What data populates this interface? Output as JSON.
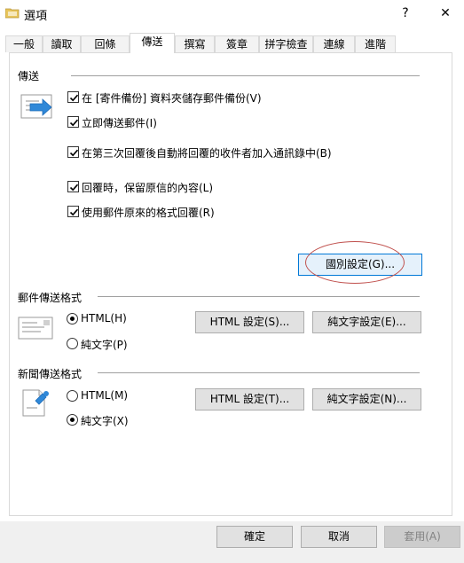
{
  "window": {
    "title": "選項",
    "help_button": "?",
    "close_button": "✕"
  },
  "tabs": [
    {
      "label": "一般"
    },
    {
      "label": "讀取"
    },
    {
      "label": "回條"
    },
    {
      "label": "傳送",
      "active": true
    },
    {
      "label": "撰寫"
    },
    {
      "label": "簽章"
    },
    {
      "label": "拼字檢查"
    },
    {
      "label": "連線"
    },
    {
      "label": "進階"
    }
  ],
  "send_section": {
    "heading": "傳送",
    "icon": "send-mail-icon",
    "options": [
      {
        "label": "在 [寄件備份] 資料夾儲存郵件備份(V)",
        "checked": true
      },
      {
        "label": "立即傳送郵件(I)",
        "checked": true
      },
      {
        "label": "在第三次回覆後自動將回覆的收件者加入通訊錄中(B)",
        "checked": true
      },
      {
        "label": "回覆時，保留原信的內容(L)",
        "checked": true
      },
      {
        "label": "使用郵件原來的格式回覆(R)",
        "checked": true
      }
    ],
    "intl_button": "國別設定(G)..."
  },
  "mail_format": {
    "heading": "郵件傳送格式",
    "icon": "envelope-icon",
    "html_option": "HTML(H)",
    "plain_option": "純文字(P)",
    "selected": "html",
    "html_settings_button": "HTML 設定(S)...",
    "plain_settings_button": "純文字設定(E)..."
  },
  "news_format": {
    "heading": "新聞傳送格式",
    "icon": "news-post-icon",
    "html_option": "HTML(M)",
    "plain_option": "純文字(X)",
    "selected": "plain",
    "html_settings_button": "HTML 設定(T)...",
    "plain_settings_button": "純文字設定(N)..."
  },
  "footer": {
    "ok_button": "確定",
    "cancel_button": "取消",
    "apply_button": "套用(A)"
  },
  "colors": {
    "annotation": "#c0504d",
    "focus_border": "#0078d7",
    "icon_blue": "#2f88d8"
  }
}
